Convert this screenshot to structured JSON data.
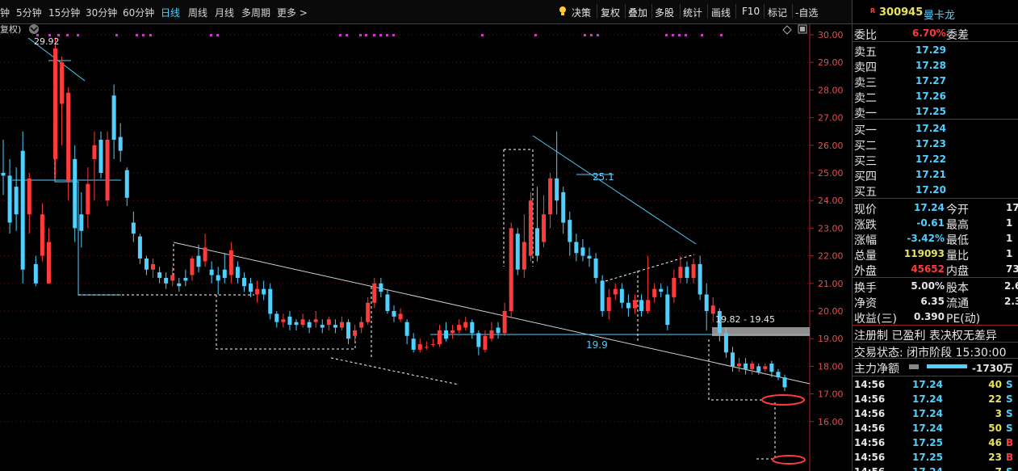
{
  "toolbar": {
    "periods": [
      "钟",
      "5分钟",
      "15分钟",
      "30分钟",
      "60分钟",
      "日线",
      "周线",
      "月线",
      "多周期",
      "更多 >"
    ],
    "active_period": "日线",
    "tools": [
      "决策",
      "复权",
      "叠加",
      "多股",
      "统计",
      "画线",
      "F10",
      "标记",
      "-自选"
    ]
  },
  "chart": {
    "rights_label": "复权)",
    "high_marker": "29.92",
    "annotation_25_1": "25.1",
    "annotation_19_9": "19.9",
    "zone_label": "19.82 - 19.45",
    "y_axis_labels": [
      "30.00",
      "29.00",
      "28.00",
      "27.00",
      "26.00",
      "25.00",
      "24.00",
      "23.00",
      "22.00",
      "21.00",
      "20.00",
      "19.00",
      "18.00",
      "17.00",
      "16.00"
    ],
    "colors": {
      "up": "#ff3b3b",
      "down": "#4fd0ff",
      "trend": "#ffffff",
      "axis": "#b02020"
    }
  },
  "quote": {
    "code": "300945",
    "name": "曼卡龙",
    "badge": "R",
    "webi_label": "委比",
    "webi_value": "6.70%",
    "weicha_label": "委差",
    "sells": [
      {
        "label": "卖五",
        "price": "17.29"
      },
      {
        "label": "卖四",
        "price": "17.28"
      },
      {
        "label": "卖三",
        "price": "17.27"
      },
      {
        "label": "卖二",
        "price": "17.26"
      },
      {
        "label": "卖一",
        "price": "17.25"
      }
    ],
    "buys": [
      {
        "label": "买一",
        "price": "17.24"
      },
      {
        "label": "买二",
        "price": "17.23"
      },
      {
        "label": "买三",
        "price": "17.22"
      },
      {
        "label": "买四",
        "price": "17.21"
      },
      {
        "label": "买五",
        "price": "17.20"
      }
    ],
    "stats": [
      {
        "l1": "现价",
        "v1": "17.24",
        "l2": "今开",
        "v2": "17"
      },
      {
        "l1": "涨跌",
        "v1": "-0.61",
        "l2": "最高",
        "v2": "1"
      },
      {
        "l1": "涨幅",
        "v1": "-3.42%",
        "l2": "最低",
        "v2": "1"
      },
      {
        "l1": "总量",
        "v1": "119093",
        "l2": "量比",
        "v2": "1"
      },
      {
        "l1": "外盘",
        "v1": "45652",
        "l2": "内盘",
        "v2": "73"
      }
    ],
    "stats2": [
      {
        "l1": "换手",
        "v1": "5.00%",
        "l2": "股本",
        "v2": "2.6"
      },
      {
        "l1": "净资",
        "v1": "6.35",
        "l2": "流通",
        "v2": "2.3"
      },
      {
        "l1": "收益(三)",
        "v1": "0.390",
        "l2": "PE(动)",
        "v2": ""
      }
    ],
    "reg_line": "注册制 已盈利 表决权无差异",
    "status_line": "交易状态: 闭市阶段 15:30:00",
    "main_flow_label": "主力净额",
    "main_flow_value": "-1730万",
    "ticks": [
      {
        "t": "14:56",
        "p": "17.24",
        "v": "40",
        "s": "S"
      },
      {
        "t": "14:56",
        "p": "17.24",
        "v": "22",
        "s": "S"
      },
      {
        "t": "14:56",
        "p": "17.24",
        "v": "3",
        "s": "S"
      },
      {
        "t": "14:56",
        "p": "17.24",
        "v": "50",
        "s": "S"
      },
      {
        "t": "14:56",
        "p": "17.25",
        "v": "46",
        "s": "B"
      },
      {
        "t": "14:56",
        "p": "17.25",
        "v": "23",
        "s": "B"
      },
      {
        "t": "14:56",
        "p": "17.24",
        "v": "7",
        "s": "S"
      }
    ]
  }
}
